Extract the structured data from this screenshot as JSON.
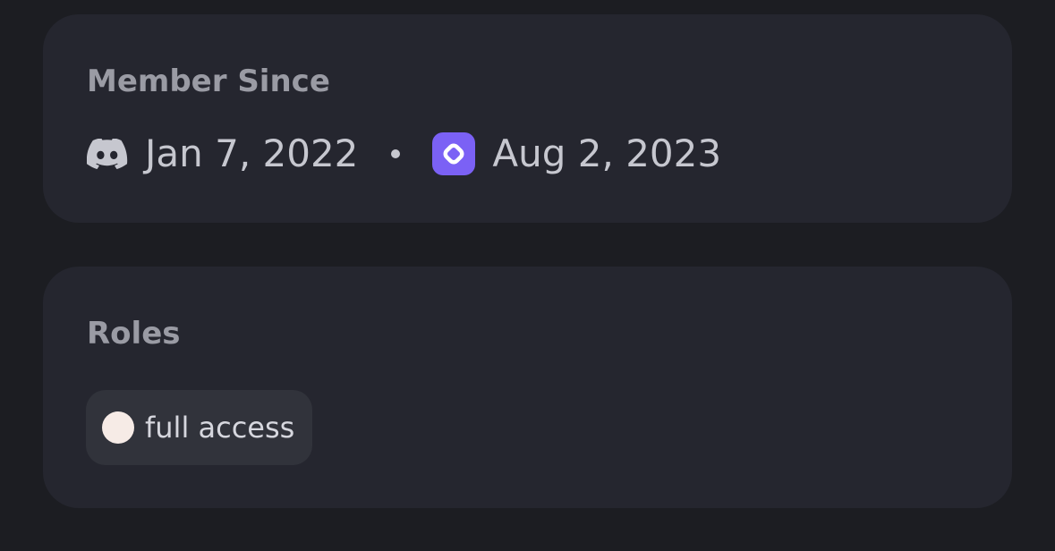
{
  "member_since": {
    "title": "Member Since",
    "discord_date": "Jan 7, 2022",
    "server_date": "Aug 2, 2023",
    "discord_icon": "discord-logo-icon",
    "server_icon": "server-icon",
    "server_icon_color": "#7b61f5"
  },
  "roles": {
    "title": "Roles",
    "items": [
      {
        "label": "full access",
        "color": "#f6ebe6"
      }
    ]
  }
}
